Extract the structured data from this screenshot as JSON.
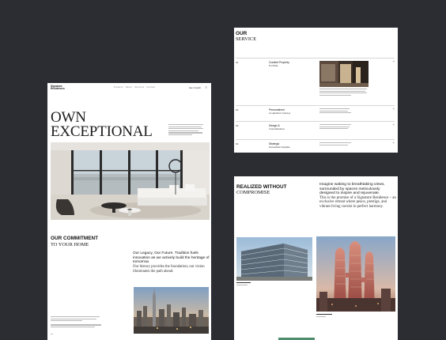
{
  "landing": {
    "brand": "Signature\nResidences",
    "nav_links": "Projects   About   Services   Contact",
    "nav_cta": "Get in touch",
    "menu_icon": "menu-icon",
    "hero_title_line1": "OWN",
    "hero_title_line2": "EXCEPTIONAL",
    "commitment_bold": "OUR COMMITMENT",
    "commitment_thin": "TO YOUR HOME",
    "commitment_body_bold": "Our Legacy, Our Future. Tradition fuels innovation as we actively build the heritage of tomorrow.",
    "commitment_body_serif": "Our history provides the foundation; our vision illuminates the path ahead."
  },
  "services": {
    "title_bold": "OUR",
    "title_thin": "SERVICE",
    "items": [
      {
        "num": "01",
        "name_bold": "Curated Property",
        "name_thin": "Portfolio",
        "icon": "plus-icon"
      },
      {
        "num": "02",
        "name_bold": "Personalized",
        "name_thin": "Acquisition Journey",
        "icon": "plus-icon"
      },
      {
        "num": "03",
        "name_bold": "Design &",
        "name_thin": "Customization",
        "icon": "plus-icon"
      },
      {
        "num": "04",
        "name_bold": "Strategic",
        "name_thin": "Investment Insights",
        "icon": "plus-icon"
      }
    ]
  },
  "realized": {
    "title_bold": "REALIZED WITHOUT",
    "title_thin": "COMPROMISE",
    "body_bold": "Imagine waking to breathtaking views, surrounded by spaces meticulously designed to inspire and rejuvenate.",
    "body_serif": "This is the promise of a Signature Residence – an exclusive retreat where peace, prestige, and vibrant living coexist in perfect harmony."
  },
  "colors": {
    "background": "#2c2d33",
    "card": "#ffffff",
    "accent_green": "#4f8c6b"
  }
}
